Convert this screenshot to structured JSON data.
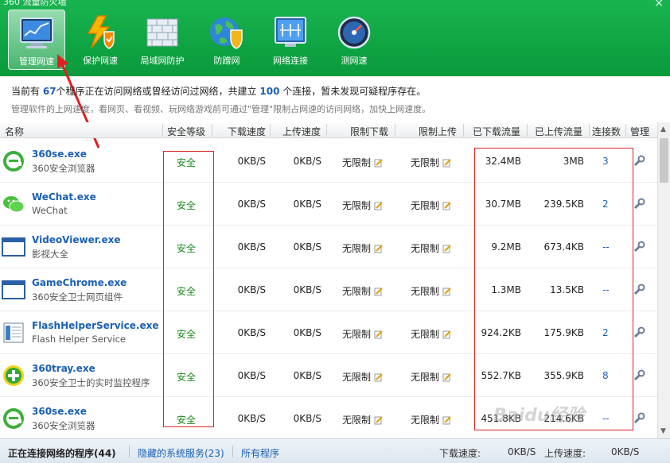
{
  "window": {
    "title": "360 流量防火墙",
    "close_glyph": "×"
  },
  "toolbar": {
    "buttons": [
      {
        "label": "管理网速",
        "icon": "monitor-chart-icon",
        "active": true
      },
      {
        "label": "保护网速",
        "icon": "lightning-shield-icon",
        "active": false
      },
      {
        "label": "局域网防护",
        "icon": "brick-wall-icon",
        "active": false
      },
      {
        "label": "防蹭网",
        "icon": "globe-shield-icon",
        "active": false
      },
      {
        "label": "网络连接",
        "icon": "network-screen-icon",
        "active": false
      },
      {
        "label": "测网速",
        "icon": "speedometer-icon",
        "active": false
      }
    ]
  },
  "info": {
    "line1_pre": "当前有",
    "program_count": "67",
    "line1_mid": "个程序正在访问网络或曾经访问过网络，共建立",
    "connection_count": "100",
    "line1_post": "个连接，暂未发现可疑程序存在。",
    "line2": "管理软件的上网速度，看网页、看视频、玩网络游戏前可通过\"管理\"限制占网速的访问网络，加快上网速度。"
  },
  "table": {
    "headers": {
      "name": "名称",
      "safety": "安全等级",
      "download_speed": "下载速度",
      "upload_speed": "上传速度",
      "limit_download": "限制下载",
      "limit_upload": "限制上传",
      "downloaded": "已下载流量",
      "uploaded": "已上传流量",
      "connections": "连接数",
      "manage": "管理"
    },
    "rows": [
      {
        "name": "360se.exe",
        "desc": "360安全浏览器",
        "icon": "ie-e-icon",
        "safety": "安全",
        "down": "0KB/S",
        "up": "0KB/S",
        "limit_down": "无限制",
        "limit_up": "无限制",
        "downloaded": "32.4MB",
        "uploaded": "3MB",
        "connections": "3"
      },
      {
        "name": "WeChat.exe",
        "desc": "WeChat",
        "icon": "wechat-icon",
        "safety": "安全",
        "down": "0KB/S",
        "up": "0KB/S",
        "limit_down": "无限制",
        "limit_up": "无限制",
        "downloaded": "30.7MB",
        "uploaded": "239.5KB",
        "connections": "2"
      },
      {
        "name": "VideoViewer.exe",
        "desc": "影视大全",
        "icon": "window-app-icon",
        "safety": "安全",
        "down": "0KB/S",
        "up": "0KB/S",
        "limit_down": "无限制",
        "limit_up": "无限制",
        "downloaded": "9.2MB",
        "uploaded": "673.4KB",
        "connections": "--"
      },
      {
        "name": "GameChrome.exe",
        "desc": "360安全卫士网页组件",
        "icon": "window-app-icon",
        "safety": "安全",
        "down": "0KB/S",
        "up": "0KB/S",
        "limit_down": "无限制",
        "limit_up": "无限制",
        "downloaded": "1.3MB",
        "uploaded": "13.5KB",
        "connections": "--"
      },
      {
        "name": "FlashHelperService.exe",
        "desc": "Flash Helper Service",
        "icon": "document-app-icon",
        "safety": "安全",
        "down": "0KB/S",
        "up": "0KB/S",
        "limit_down": "无限制",
        "limit_up": "无限制",
        "downloaded": "924.2KB",
        "uploaded": "175.9KB",
        "connections": "2"
      },
      {
        "name": "360tray.exe",
        "desc": "360安全卫士的实时监控程序",
        "icon": "green-plus-icon",
        "safety": "安全",
        "down": "0KB/S",
        "up": "0KB/S",
        "limit_down": "无限制",
        "limit_up": "无限制",
        "downloaded": "552.7KB",
        "uploaded": "355.9KB",
        "connections": "8"
      },
      {
        "name": "360se.exe",
        "desc": "360安全浏览器",
        "icon": "ie-e-icon",
        "safety": "安全",
        "down": "0KB/S",
        "up": "0KB/S",
        "limit_down": "无限制",
        "limit_up": "无限制",
        "downloaded": "451.8KB",
        "uploaded": "214.6KB",
        "connections": "--"
      }
    ]
  },
  "statusbar": {
    "tab_connected": "正在连接网络的程序(44)",
    "tab_hidden": "隐藏的系统服务(23)",
    "tab_all": "所有程序",
    "download_label": "下载速度:",
    "download_value": "0KB/S",
    "upload_label": "上传速度:",
    "upload_value": "0KB/S"
  },
  "watermark": "Baidu经验",
  "colors": {
    "toolbar_green": "#12a845",
    "link_blue": "#1a5fb4",
    "safe_green": "#1c8a1c",
    "highlight_red": "#e02020"
  }
}
